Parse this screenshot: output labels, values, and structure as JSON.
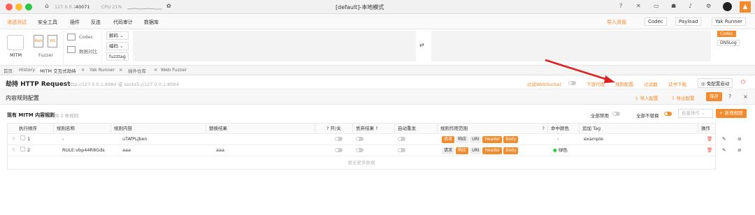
{
  "titlebar": {
    "ip": "127.0.0.1",
    "port": "40071",
    "cpu": "CPU 21%",
    "title": "[default]-本地模式"
  },
  "menu": [
    "渗透测试",
    "安全工具",
    "插件",
    "反连",
    "代码审计",
    "数据库"
  ],
  "menu_right": {
    "import": "导入资源",
    "codec": "Codec",
    "payload": "Payload",
    "yak_runner": "Yak Runner"
  },
  "tools": {
    "mitm": "MITM",
    "fuzzer": "Fuzzer",
    "web": "Web",
    "ws": "WS",
    "codec": "Codec",
    "compare": "数据对比",
    "decode": "解码",
    "encode": "编码",
    "fuzztag": "fuzztag",
    "codec_btn": "Codec",
    "dnslog": "DNSLog"
  },
  "tabs": [
    "首页",
    "History",
    "MITM 交互式劫持",
    "Yak Runner",
    "插件仓库",
    "Web Fuzzer"
  ],
  "header": {
    "title": "劫持 HTTP Request",
    "sub": "http://127.0.0.1:8084 或 socks5://127.0.0.1:8084",
    "ws": "过滤WebSocket",
    "proxy": "下游代理",
    "rules": "规则配置",
    "filter": "过滤器",
    "cert": "证书下载",
    "free": "免配置启动"
  },
  "panel": {
    "title": "内容规则配置",
    "import": "导入配置",
    "export": "导出配置",
    "save": "保存"
  },
  "list": {
    "title": "现有 MITM 内容规则",
    "count": "共 2 条规则",
    "disable_all": "全部禁用",
    "no_replace": "全部不替换",
    "batch": "批量操作",
    "add": "+ 新增规则"
  },
  "columns": [
    "执行顺序",
    "规则名称",
    "规则内容",
    "替换结果",
    "开/关",
    "丢弃结果",
    "自动重发",
    "规则作用范围",
    "命中颜色",
    "追加 Tag",
    "操作"
  ],
  "rows": [
    {
      "order": "1",
      "name": "-",
      "content": "uTAfPLjben",
      "replace": "",
      "color": "-",
      "tag": "example"
    },
    {
      "order": "2",
      "name": "RULE:vbp44R8Gds",
      "content": "aaa",
      "replace": "aaa",
      "color": "绿色",
      "tag": ""
    }
  ],
  "scope_tags": [
    "请求",
    "响应",
    "URI",
    "Header",
    "Body"
  ],
  "empty": "暂无更多数据"
}
